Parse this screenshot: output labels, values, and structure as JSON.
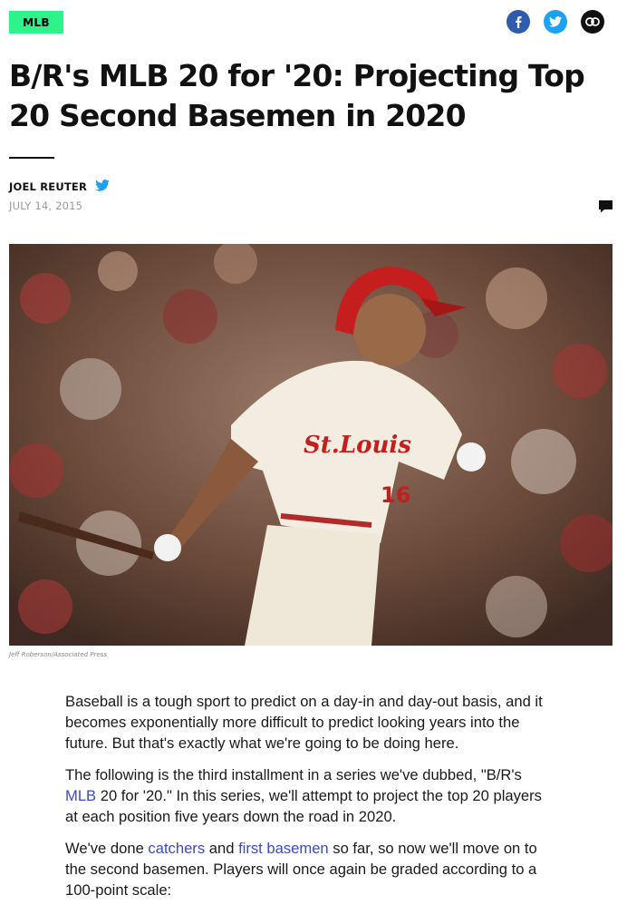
{
  "category_tag": "MLB",
  "share": {
    "facebook_icon": "facebook-icon",
    "twitter_icon": "twitter-icon",
    "link_icon": "link-icon"
  },
  "article": {
    "title": "B/R's MLB 20 for '20: Projecting Top 20 Second Basemen in 2020",
    "author": "JOEL REUTER",
    "date": "JULY 14, 2015",
    "image_credit": "Jeff Roberson/Associated Press",
    "paragraphs": {
      "p1": "Baseball is a tough sport to predict on a day-in and day-out basis, and it becomes exponentially more difficult to predict looking years into the future. But that's exactly what we're going to be doing here.",
      "p2_a": "The following is the third installment in a series we've dubbed, \"B/R's ",
      "p2_link": "MLB",
      "p2_b": " 20 for '20.\" In this series, we'll attempt to project the top 20 players at each position five years down the road in 2020.",
      "p3_a": "We've done ",
      "p3_link1": "catchers",
      "p3_b": " and ",
      "p3_link2": "first basemen",
      "p3_c": " so far, so now we'll move on to the second basemen. Players will once again be graded according to a 100-point scale:"
    }
  },
  "colors": {
    "tag_bg": "#2ef28a",
    "facebook": "#2e5cab",
    "twitter": "#1da1f2",
    "link_btn": "#111111",
    "link_text": "#3a4ac4"
  }
}
